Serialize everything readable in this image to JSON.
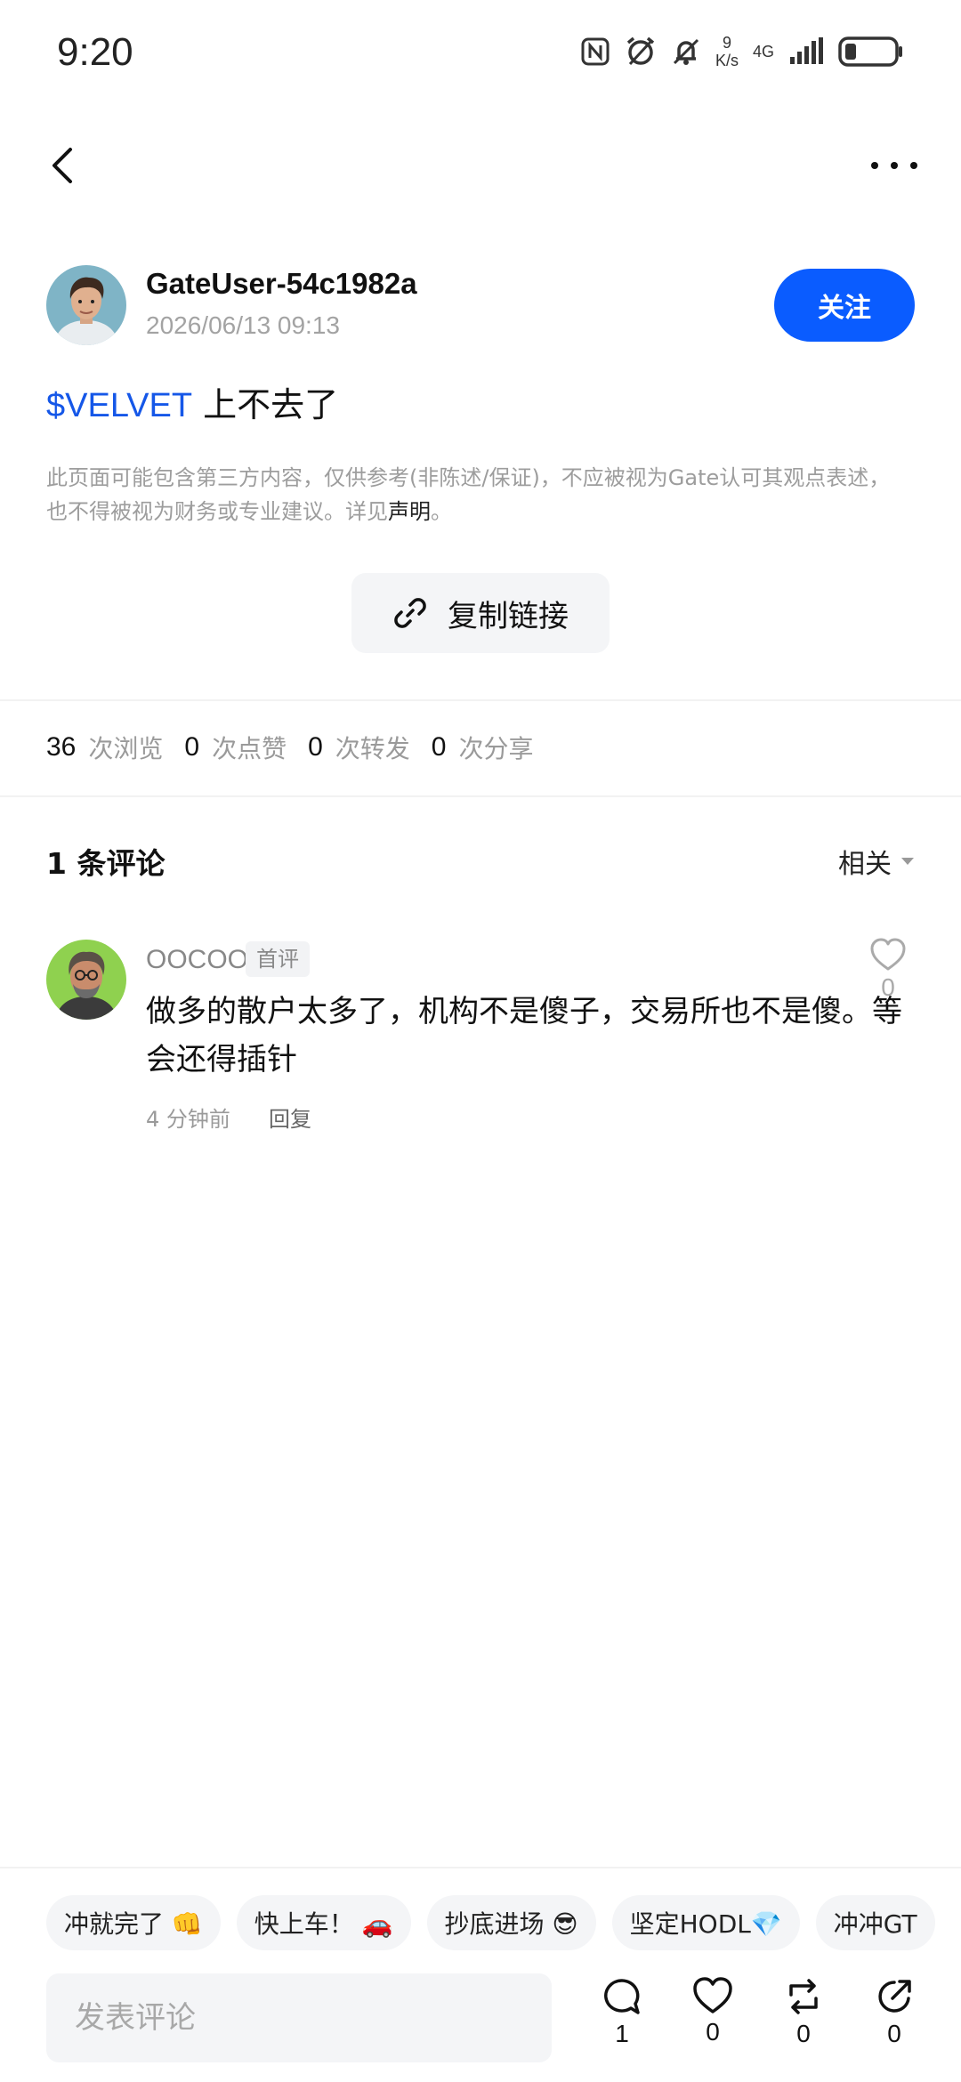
{
  "status_bar": {
    "time": "9:20",
    "net_speed_value": "9",
    "net_speed_unit": "K/s",
    "network_type": "4G",
    "icons": [
      "nfc-icon",
      "alarm-icon",
      "mute-icon",
      "signal-icon",
      "battery-icon"
    ]
  },
  "topbar": {
    "back_icon": "chevron-left-icon",
    "more_icon": "more-icon"
  },
  "author": {
    "name": "GateUser-54c1982a",
    "date": "2026/06/13 09:13",
    "follow_label": "关注"
  },
  "post": {
    "tag": "$VELVET",
    "text": "上不去了"
  },
  "disclaimer": {
    "text": "此页面可能包含第三方内容，仅供参考(非陈述/保证)，不应被视为Gate认可其观点表述，也不得被视为财务或专业建议。详见",
    "link": "声明",
    "suffix": "。"
  },
  "copy_link": {
    "label": "复制链接"
  },
  "stats": [
    {
      "value": "36",
      "label": "次浏览"
    },
    {
      "value": "0",
      "label": "次点赞"
    },
    {
      "value": "0",
      "label": "次转发"
    },
    {
      "value": "0",
      "label": "次分享"
    }
  ],
  "comments_header": {
    "count_label": "1 条评论",
    "sort_label": "相关"
  },
  "comments": [
    {
      "user": "OOCOO",
      "badge": "首评",
      "text": "做多的散户太多了，机构不是傻子，交易所也不是傻。等会还得插针",
      "time": "4 分钟前",
      "reply_label": "回复",
      "likes": "0"
    }
  ],
  "quick_replies": [
    "冲就完了 👊",
    "快上车！ 🚗",
    "抄底进场 😎",
    "坚定HODL💎",
    "冲冲GT"
  ],
  "bottom_bar": {
    "input_placeholder": "发表评论",
    "actions": [
      {
        "icon": "comment-icon",
        "count": "1"
      },
      {
        "icon": "heart-icon",
        "count": "0"
      },
      {
        "icon": "repost-icon",
        "count": "0"
      },
      {
        "icon": "share-icon",
        "count": "0"
      }
    ]
  },
  "colors": {
    "accent": "#0a5cff",
    "tag": "#1557e8",
    "muted": "#9a9a9a"
  }
}
